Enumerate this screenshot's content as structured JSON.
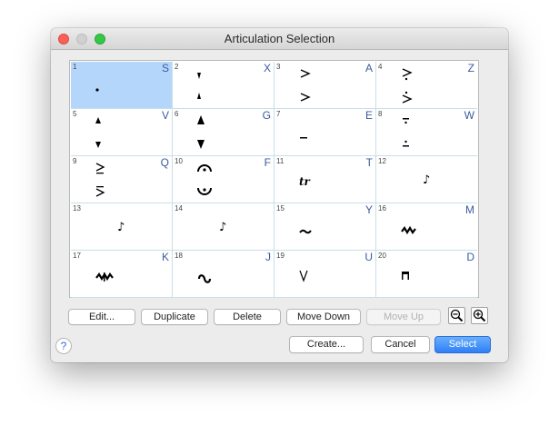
{
  "window": {
    "title": "Articulation Selection"
  },
  "cells": [
    {
      "num": "1",
      "key": "S",
      "icon": "staccato-icon"
    },
    {
      "num": "2",
      "key": "X",
      "icon": "staccatissimo-icon"
    },
    {
      "num": "3",
      "key": "A",
      "icon": "accent-icon"
    },
    {
      "num": "4",
      "key": "Z",
      "icon": "accent-staccato-icon"
    },
    {
      "num": "5",
      "key": "V",
      "icon": "marcato-small-icon"
    },
    {
      "num": "6",
      "key": "G",
      "icon": "marcato-icon"
    },
    {
      "num": "7",
      "key": "E",
      "icon": "tenuto-icon"
    },
    {
      "num": "8",
      "key": "W",
      "icon": "tenuto-staccato-icon"
    },
    {
      "num": "9",
      "key": "Q",
      "icon": "accent-tenuto-icon"
    },
    {
      "num": "10",
      "key": "F",
      "icon": "fermata-icon"
    },
    {
      "num": "11",
      "key": "T",
      "icon": "trill-icon"
    },
    {
      "num": "12",
      "key": "",
      "icon": "grace-note-icon"
    },
    {
      "num": "13",
      "key": "",
      "icon": "grace-note-icon"
    },
    {
      "num": "14",
      "key": "",
      "icon": "grace-note-icon"
    },
    {
      "num": "15",
      "key": "Y",
      "icon": "mordent-icon"
    },
    {
      "num": "16",
      "key": "M",
      "icon": "inverted-mordent-icon"
    },
    {
      "num": "17",
      "key": "K",
      "icon": "long-mordent-icon"
    },
    {
      "num": "18",
      "key": "J",
      "icon": "turn-icon"
    },
    {
      "num": "19",
      "key": "U",
      "icon": "bow-icon"
    },
    {
      "num": "20",
      "key": "D",
      "icon": "down-bow-icon"
    }
  ],
  "buttons": {
    "edit": "Edit...",
    "duplicate": "Duplicate",
    "delete": "Delete",
    "move_down": "Move Down",
    "move_up": "Move Up",
    "create": "Create...",
    "cancel": "Cancel",
    "select": "Select",
    "help": "?"
  },
  "zoom": {
    "out_icon": "zoom-out-icon",
    "in_icon": "zoom-in-icon"
  },
  "colors": {
    "selection": "#b4d6fb",
    "primary": "#3b86f7",
    "key_text": "#3b5ba0",
    "grid_line": "#c9dfe6"
  }
}
